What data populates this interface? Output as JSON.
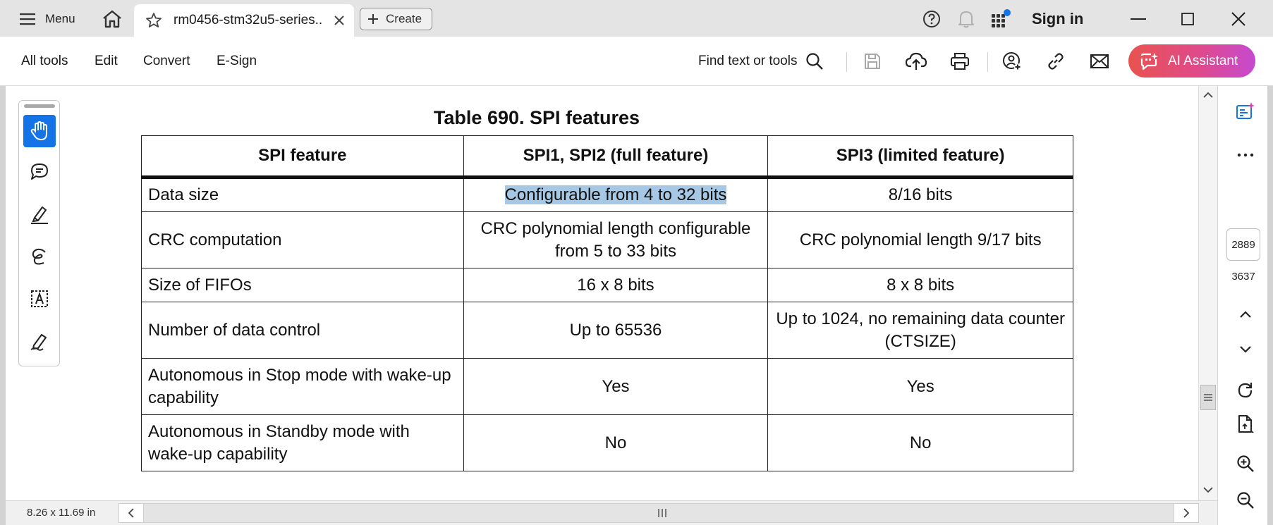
{
  "tabbar": {
    "menu_label": "Menu",
    "tab_title": "rm0456-stm32u5-series...",
    "create_label": "Create",
    "sign_in_label": "Sign in"
  },
  "toolbar": {
    "items": [
      "All tools",
      "Edit",
      "Convert",
      "E-Sign"
    ],
    "find_label": "Find text or tools",
    "ai_label": "AI Assistant"
  },
  "document": {
    "table_title": "Table 690. SPI features",
    "headers": [
      "SPI feature",
      "SPI1, SPI2 (full feature)",
      "SPI3 (limited feature)"
    ],
    "rows": [
      {
        "feature": "Data size",
        "full": "Configurable from 4 to 32 bits",
        "limited": "8/16 bits"
      },
      {
        "feature": "CRC computation",
        "full": "CRC polynomial length configurable from 5 to 33 bits",
        "limited": "CRC polynomial length 9/17 bits"
      },
      {
        "feature": "Size of FIFOs",
        "full": "16 x 8 bits",
        "limited": "8 x 8 bits"
      },
      {
        "feature": "Number of data control",
        "full": "Up to 65536",
        "limited": "Up to 1024, no remaining data counter (CTSIZE)"
      },
      {
        "feature": "Autonomous in Stop mode with wake-up capability",
        "full": "Yes",
        "limited": "Yes"
      },
      {
        "feature": "Autonomous in Standby mode with wake-up capability",
        "full": "No",
        "limited": "No"
      }
    ]
  },
  "statusbar": {
    "page_size": "8.26 x 11.69 in"
  },
  "page_nav": {
    "current_page": "2889",
    "total_pages": "3637"
  },
  "colors": {
    "accent": "#1473e6",
    "selection": "#a7c8e4",
    "ai_gradient_start": "#e8534f",
    "ai_gradient_end": "#c64ad0"
  }
}
